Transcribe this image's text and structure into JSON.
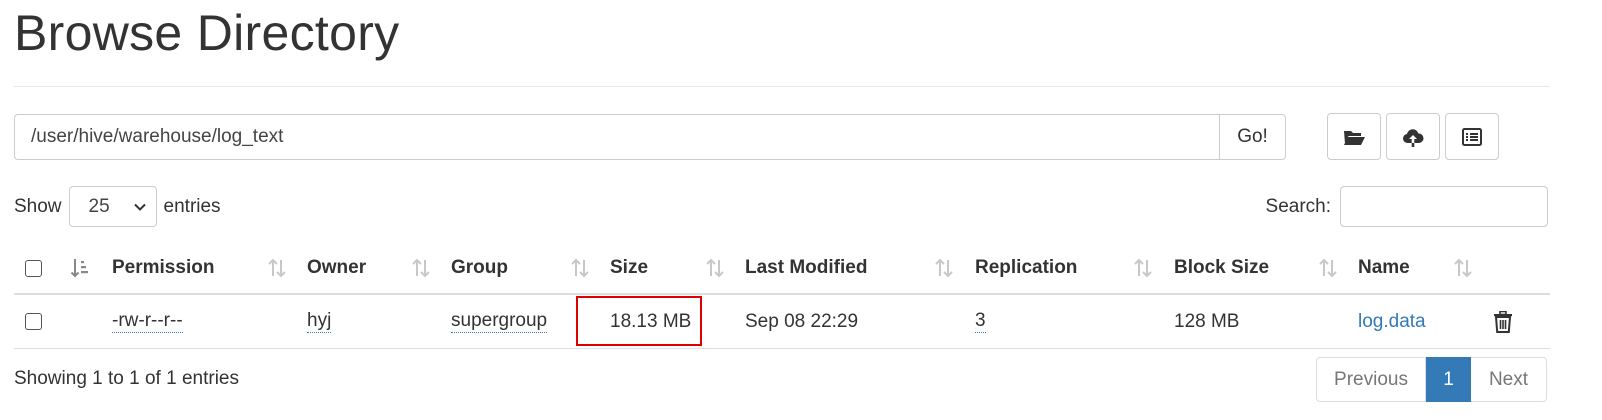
{
  "page": {
    "title": "Browse Directory"
  },
  "path_bar": {
    "value": "/user/hive/warehouse/log_text",
    "go_label": "Go!"
  },
  "toolbar": {
    "buttons": [
      "folder-open-icon",
      "cloud-upload-icon",
      "list-alt-icon"
    ]
  },
  "length_control": {
    "show_label": "Show",
    "selected": "25",
    "entries_label": "entries"
  },
  "search": {
    "label": "Search:",
    "value": ""
  },
  "table": {
    "headers": [
      "Permission",
      "Owner",
      "Group",
      "Size",
      "Last Modified",
      "Replication",
      "Block Size",
      "Name"
    ],
    "rows": [
      {
        "checked": false,
        "permission": "-rw-r--r--",
        "owner": "hyj",
        "group": "supergroup",
        "size": "18.13 MB",
        "last_modified": "Sep 08 22:29",
        "replication": "3",
        "block_size": "128 MB",
        "name": "log.data"
      }
    ]
  },
  "info_text": "Showing 1 to 1 of 1 entries",
  "pagination": {
    "previous": "Previous",
    "current": "1",
    "next": "Next"
  },
  "colors": {
    "link": "#337ab7",
    "highlight": "#e00000",
    "active_page": "#337ab7"
  }
}
